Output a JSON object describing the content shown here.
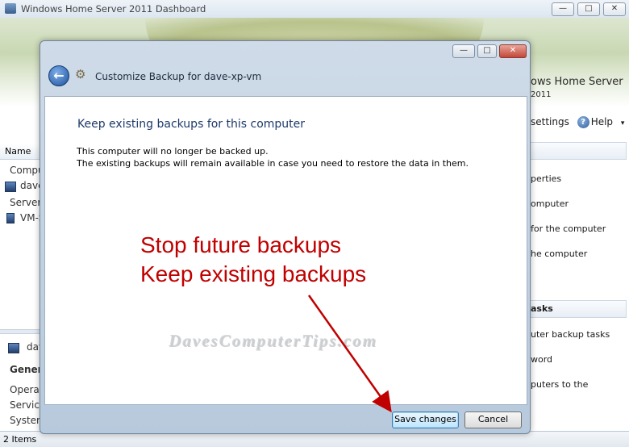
{
  "window": {
    "title": "Windows Home Server 2011 Dashboard",
    "controls": {
      "minimize": "—",
      "maximize": "□",
      "close": "✕"
    }
  },
  "banner": {
    "brand": "ows Home Server",
    "version": "2011"
  },
  "toolbar": {
    "settings": "settings",
    "help": "Help",
    "help_arrow": "▾"
  },
  "left_pane": {
    "column_header": "Name",
    "rows": [
      "Compu",
      "dave",
      "Server",
      "VM-S"
    ],
    "lower_title": "dav",
    "section": "Genera",
    "details": [
      "Operat",
      "Service",
      "System"
    ]
  },
  "status_bar": {
    "items_count": "2 Items"
  },
  "right_pane": {
    "items_top": [
      "perties",
      "omputer",
      "for the computer",
      "he computer"
    ],
    "section_head": "asks",
    "items_bottom": [
      "uter backup tasks",
      "word",
      "puters to the"
    ]
  },
  "dialog": {
    "title": "Customize Backup for dave-xp-vm",
    "heading": "Keep existing backups for this computer",
    "line1": "This computer will no longer be backed up.",
    "line2": "The existing backups will remain available in case you need to restore the data in them.",
    "annotation_line1": "Stop future backups",
    "annotation_line2": "Keep existing backups",
    "watermark": "DavesComputerTips.com",
    "save_label": "Save changes",
    "cancel_label": "Cancel",
    "back_glyph": "←",
    "gear_glyph": "⚙",
    "controls": {
      "minimize": "—",
      "maximize": "□",
      "close": "✕"
    }
  },
  "colors": {
    "annotation": "#c00000",
    "heading": "#1d3a6b",
    "primary_button": "#bee6fd"
  },
  "icons": [
    "app-icon",
    "back-arrow-icon",
    "gear-icon",
    "help-icon",
    "computer-icon"
  ]
}
